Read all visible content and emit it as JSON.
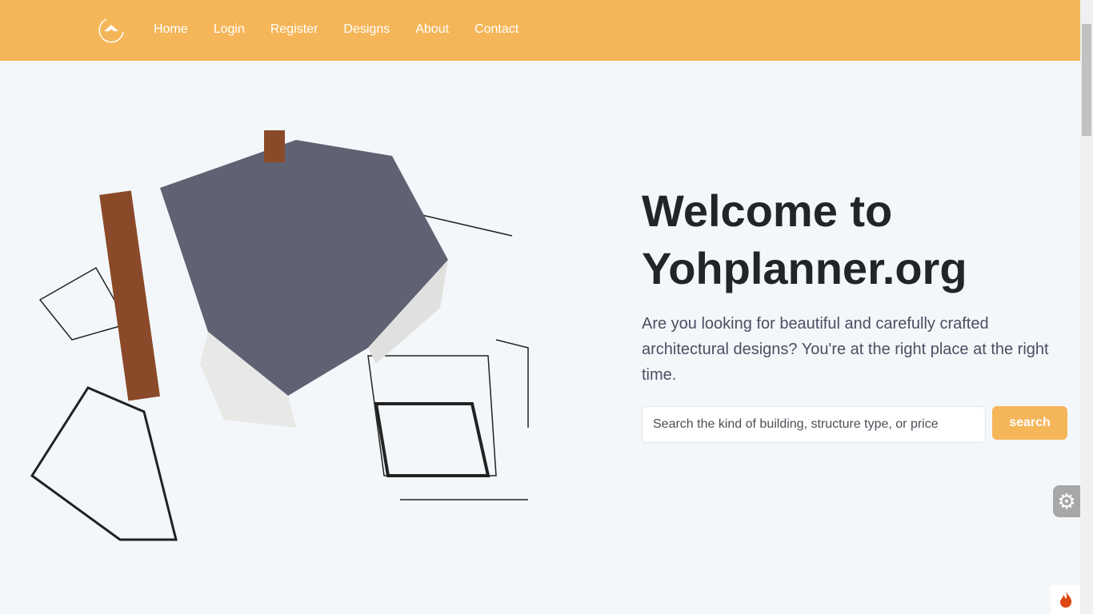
{
  "nav": {
    "items": [
      "Home",
      "Login",
      "Register",
      "Designs",
      "About",
      "Contact"
    ]
  },
  "hero": {
    "title_line1": "Welcome to",
    "title_line2": "Yohplanner.org",
    "subtitle": "Are you looking for beautiful and carefully crafted architectural designs? You're at the right place at the right time.",
    "search_placeholder": "Search the kind of building, structure type, or price",
    "search_label": "search"
  },
  "colors": {
    "accent": "#f5b659",
    "background": "#f3f7fa"
  }
}
